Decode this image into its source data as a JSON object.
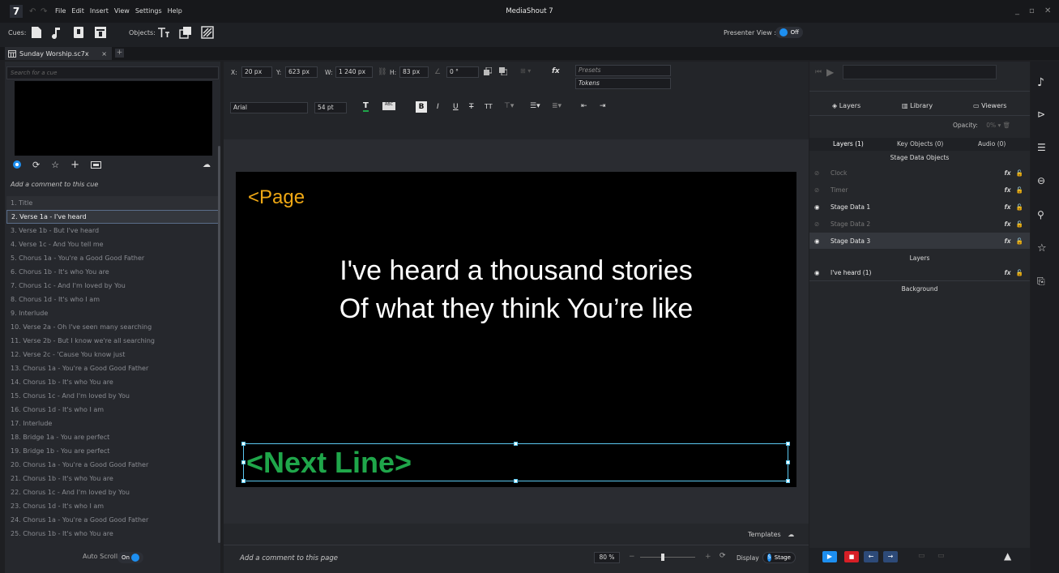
{
  "window": {
    "logo": "7",
    "title": "MediaShout 7",
    "menu": [
      "File",
      "Edit",
      "Insert",
      "View",
      "Settings",
      "Help"
    ]
  },
  "toolbar": {
    "cues_label": "Cues:",
    "objects_label": "Objects:",
    "presenter_view_label": "Presenter View :",
    "presenter_toggle": "Off"
  },
  "tab": {
    "name": "Sunday Worship.sc7x",
    "close": "×",
    "add": "+"
  },
  "left": {
    "search_placeholder": "Search for a cue",
    "comment_placeholder": "Add a comment to this cue",
    "cues": [
      "1. Title",
      "2. Verse 1a - I've heard",
      "3. Verse 1b - But I've heard",
      "4. Verse 1c - And You tell me",
      "5. Chorus 1a - You're a Good Good Father",
      "6. Chorus 1b - It's who You are",
      "7. Chorus 1c - And I'm loved by You",
      "8. Chorus 1d - It's who I am",
      "9. Interlude",
      "10. Verse 2a - Oh I've seen many searching",
      "11. Verse 2b - But I know we're all searching",
      "12. Verse 2c - 'Cause You know just",
      "13. Chorus 1a - You're a Good Good Father",
      "14. Chorus 1b - It's who You are",
      "15. Chorus 1c - And I'm loved by You",
      "16. Chorus 1d - It's who I am",
      "17. Interlude",
      "18. Bridge 1a - You are perfect",
      "19. Bridge 1b - You are perfect",
      "20. Chorus 1a - You're a Good Good Father",
      "21. Chorus 1b - It's who You are",
      "22. Chorus 1c - And I'm loved by You",
      "23. Chorus 1d - It's who I am",
      "24. Chorus 1a - You're a Good Good Father",
      "25. Chorus 1b - It's who You are"
    ],
    "selected_index": 1,
    "autoscroll_label": "Auto Scroll",
    "autoscroll_toggle": "On"
  },
  "props": {
    "x_label": "X:",
    "x": "20 px",
    "y_label": "Y:",
    "y": "623 px",
    "w_label": "W:",
    "w": "1 240 px",
    "h_label": "H:",
    "h": "83 px",
    "rotation": "0 °",
    "presets": "Presets",
    "tokens": "Tokens",
    "font": "Arial",
    "size": "54 pt",
    "fx": "fx"
  },
  "stage": {
    "page_token": "<Page",
    "lyric_line1": "I've heard a thousand stories",
    "lyric_line2": "Of what they think You’re like",
    "next_line_token": "<Next Line>"
  },
  "bottom": {
    "templates": "Templates",
    "page_comment": "Add a comment to this page",
    "zoom": "80 %",
    "display_label": "Display",
    "display_value": "Stage"
  },
  "right": {
    "tabs": [
      "Layers",
      "Library",
      "Viewers"
    ],
    "opacity_label": "Opacity:",
    "opacity_value": "0%",
    "subtabs": [
      "Layers (1)",
      "Key Objects (0)",
      "Audio (0)"
    ],
    "stage_section": "Stage Data Objects",
    "stage_items": [
      {
        "name": "Clock",
        "visible": false
      },
      {
        "name": "Timer",
        "visible": false
      },
      {
        "name": "Stage Data 1",
        "visible": true
      },
      {
        "name": "Stage Data 2",
        "visible": false
      },
      {
        "name": "Stage Data 3",
        "visible": true
      }
    ],
    "layers_section": "Layers",
    "layer_items": [
      {
        "name": "I've heard (1)",
        "visible": true
      }
    ],
    "background_section": "Background"
  },
  "colors": {
    "accent": "#1d8ff0",
    "page_token": "#f0a814",
    "next_line": "#1fa64a",
    "selection": "#5bc8f0"
  }
}
